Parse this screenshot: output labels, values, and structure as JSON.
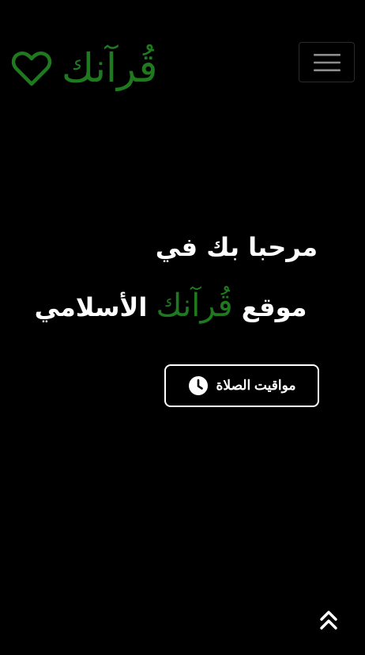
{
  "navbar": {
    "brand_text": "قُرآنك",
    "heart_icon": "heart-outline-icon",
    "menu_icon": "hamburger-menu-icon"
  },
  "hero": {
    "line1": "مرحبا بك في",
    "line2_prefix": "موقع",
    "line2_brand": "قُرآنك",
    "line2_suffix": "الأسلامي"
  },
  "prayer_button": {
    "label": "مواقيت الصلاة",
    "icon": "clock-icon"
  },
  "scroll_top": {
    "icon": "chevrons-up-icon"
  },
  "colors": {
    "background": "#000000",
    "brand_green": "#1f7a1f",
    "text": "#ffffff"
  }
}
